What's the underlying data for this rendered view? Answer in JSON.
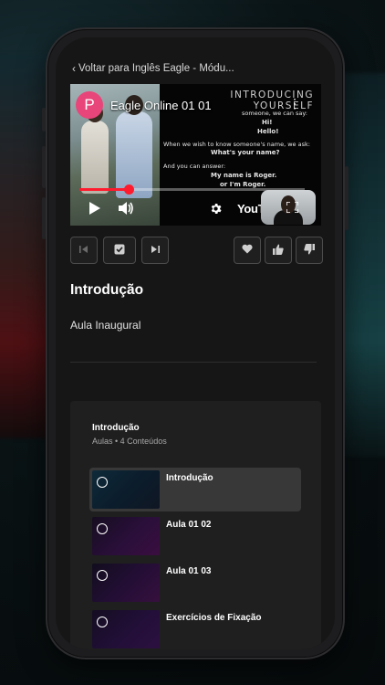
{
  "header": {
    "back_label": "Voltar para Inglês Eagle - Módu..."
  },
  "video": {
    "channel_initial": "P",
    "title": "Eagle Online 01 01",
    "slide_title": "INTRODUCING YOURSELF",
    "slide_lines": [
      "someone, we can say:",
      "Hi!",
      "Hello!",
      "When we wish to know someone's name, we ask:",
      "What's your name?",
      "And you can answer:",
      "My name is Roger.",
      "or I'm Roger."
    ],
    "progress": 0.22,
    "logo_text": "YouTube",
    "colors": {
      "progress": "#ff1b2d",
      "avatar": "#e8457a"
    }
  },
  "controls": {
    "prev_icon": "skip-previous-icon",
    "complete_icon": "check-box-icon",
    "next_icon": "skip-next-icon",
    "favorite_icon": "heart-icon",
    "like_icon": "thumbs-up-icon",
    "dislike_icon": "thumbs-down-icon"
  },
  "lesson": {
    "section_title": "Introdução",
    "lesson_title": "Aula Inaugural"
  },
  "module": {
    "title": "Introdução",
    "subtitle": "Aulas • 4 Conteúdos",
    "items": [
      {
        "label": "Introdução",
        "active": true
      },
      {
        "label": "Aula 01 02",
        "active": false
      },
      {
        "label": "Aula 01 03",
        "active": false
      },
      {
        "label": "Exercícios de Fixação",
        "active": false
      }
    ]
  }
}
